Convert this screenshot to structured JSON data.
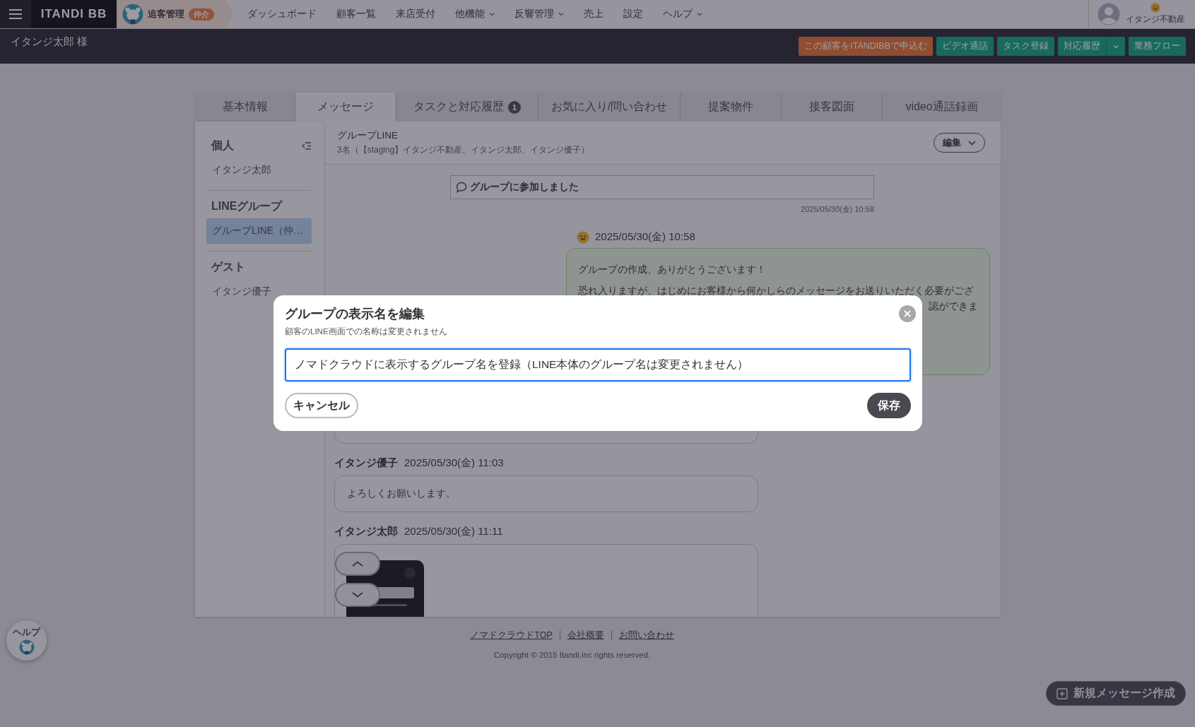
{
  "topbar": {
    "app_name": "ITANDI BB",
    "product": {
      "label": "追客管理",
      "badge": "仲介"
    },
    "nav": [
      {
        "label": "ダッシュボード",
        "dropdown": false
      },
      {
        "label": "顧客一覧",
        "dropdown": false
      },
      {
        "label": "来店受付",
        "dropdown": false
      },
      {
        "label": "他機能",
        "dropdown": true
      },
      {
        "label": "反響管理",
        "dropdown": true
      },
      {
        "label": "売上",
        "dropdown": false
      },
      {
        "label": "設定",
        "dropdown": false
      },
      {
        "label": "ヘルプ",
        "dropdown": true
      }
    ],
    "account": "イタンジ不動産"
  },
  "header": {
    "customer": "イタンジ太郎 様",
    "actions": [
      {
        "label": "この顧客をITANDIBBで申込む",
        "kind": "apply"
      },
      {
        "label": "ビデオ通話",
        "kind": "plain"
      },
      {
        "label": "タスク登録",
        "kind": "plain"
      },
      {
        "label": "対応履歴",
        "kind": "split"
      },
      {
        "label": "業務フロー",
        "kind": "plain"
      }
    ]
  },
  "tabs": [
    {
      "label": "基本情報",
      "selected": false
    },
    {
      "label": "メッセージ",
      "selected": true
    },
    {
      "label": "タスクと対応履歴",
      "selected": false,
      "badge": "1"
    },
    {
      "label": "お気に入り/問い合わせ",
      "selected": false
    },
    {
      "label": "提案物件",
      "selected": false
    },
    {
      "label": "接客図面",
      "selected": false
    },
    {
      "label": "video通話録画",
      "selected": false
    }
  ],
  "sidebar": {
    "sections": [
      {
        "title": "個人",
        "collapsible": true,
        "items": [
          {
            "label": "イタンジ太郎",
            "selected": false
          }
        ]
      },
      {
        "title": "LINEグループ",
        "collapsible": false,
        "items": [
          {
            "label": "グループLINE（仲…",
            "selected": true
          }
        ]
      },
      {
        "title": "ゲスト",
        "collapsible": false,
        "items": [
          {
            "label": "イタンジ優子",
            "selected": false
          }
        ]
      }
    ]
  },
  "chat": {
    "title": "グループLINE",
    "members": "3名（【staging】イタンジ不動産、イタンジ太郎、イタンジ優子）",
    "edit_button": "編集",
    "messages": [
      {
        "kind": "system",
        "text": "グループに参加しました",
        "time": "2025/05/30(金) 10:58"
      },
      {
        "kind": "outgoing",
        "time": "2025/05/30(金) 10:58",
        "paragraphs": [
          [
            "グループの作成、ありがとうございます！"
          ],
          [
            "恐れ入りますが、はじめにお客様から何かしらのメッセージをお送りいただく必要がござ",
            "認ができま"
          ]
        ]
      },
      {
        "kind": "covered"
      },
      {
        "kind": "incoming",
        "sender": "イタンジ優子",
        "time": "2025/05/30(金) 11:03",
        "text": "よろしくお願いします。"
      },
      {
        "sender": "イタンジ太郎",
        "time": "2025/05/30(金) 11:11"
      }
    ]
  },
  "footer": {
    "links": [
      "ノマドクラウドTOP",
      "会社概要",
      "お問い合わせ"
    ],
    "copyright": "Copyright © 2015 Itandi.inc rights reserved."
  },
  "help_button": "ヘルプ",
  "new_message_button": "新規メッセージ作成",
  "modal": {
    "title": "グループの表示名を編集",
    "note": "顧客のLINE画面での名称は変更されません",
    "value": "ノマドクラウドに表示するグループ名を登録（LINE本体のグループ名は変更されません）",
    "focused": true,
    "cancel": "キャンセル",
    "save": "保存"
  }
}
